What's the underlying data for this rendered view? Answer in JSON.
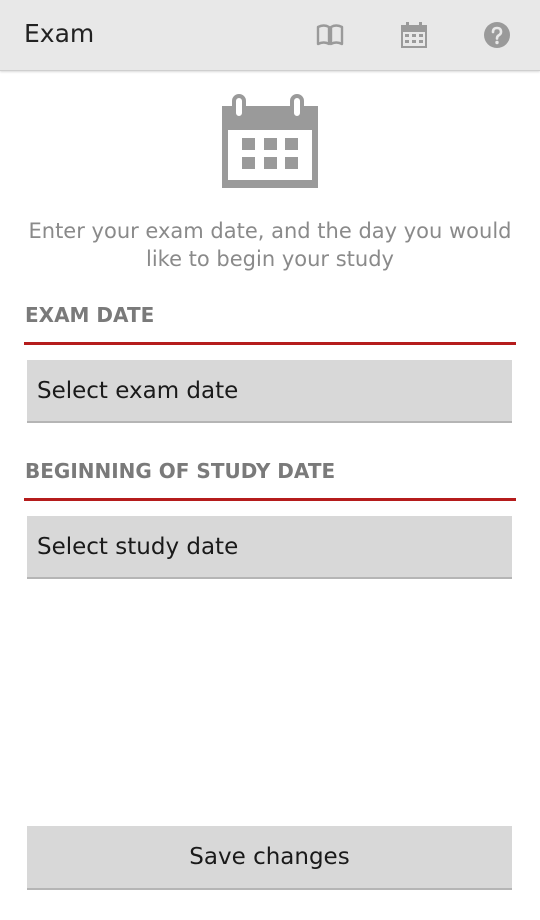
{
  "action_bar": {
    "title": "Exam",
    "icons": [
      "book-icon",
      "calendar-icon",
      "help-icon"
    ]
  },
  "hero": {
    "icon": "calendar-icon",
    "intro_text": "Enter your exam date, and the day you would like to begin your study"
  },
  "exam_section": {
    "label": "EXAM DATE",
    "button_label": "Select exam date"
  },
  "study_section": {
    "label": "BEGINNING OF STUDY DATE",
    "button_label": "Select study date"
  },
  "footer": {
    "save_label": "Save changes"
  },
  "colors": {
    "action_bar_bg": "#e8e8e8",
    "accent_rule": "#b51c1c",
    "icon_gray": "#9a9a9a",
    "button_bg": "#d8d8d8"
  }
}
